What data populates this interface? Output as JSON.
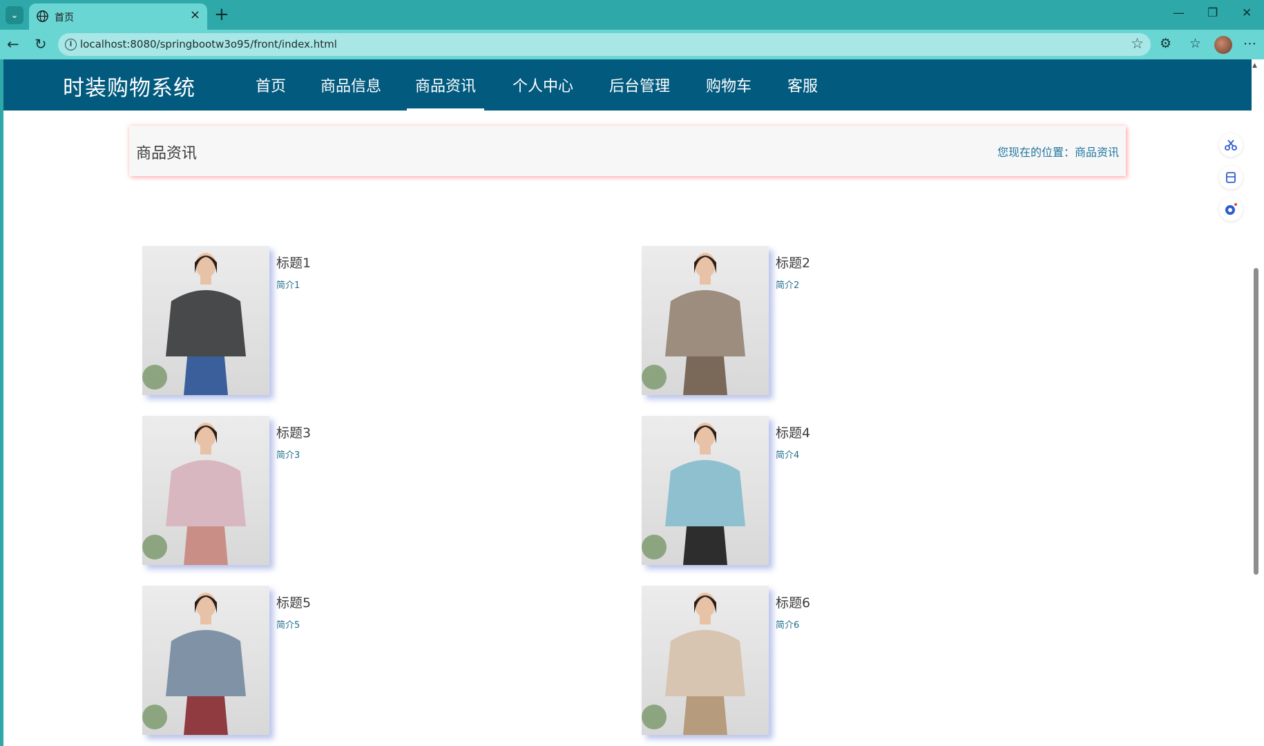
{
  "browser": {
    "tab_title": "首页",
    "url": "localhost:8080/springbootw3o95/front/index.html"
  },
  "site": {
    "logo": "时装购物系统",
    "menu": [
      {
        "label": "首页"
      },
      {
        "label": "商品信息"
      },
      {
        "label": "商品资讯",
        "active": true
      },
      {
        "label": "个人中心"
      },
      {
        "label": "后台管理"
      },
      {
        "label": "购物车"
      },
      {
        "label": "客服"
      }
    ]
  },
  "breadcrumb": {
    "title": "商品资讯",
    "position_label": "您现在的位置：",
    "position_value": "商品资讯"
  },
  "news": [
    {
      "title": "标题1",
      "intro": "简介1",
      "sweater": "#48494a",
      "pants": "#3b5f9a",
      "skin": "#e7c2a6"
    },
    {
      "title": "标题2",
      "intro": "简介2",
      "sweater": "#9c8d7e",
      "pants": "#7a6958",
      "skin": "#e7c2a6"
    },
    {
      "title": "标题3",
      "intro": "简介3",
      "sweater": "#d9b7c0",
      "pants": "#c98f86",
      "skin": "#e7c2a6"
    },
    {
      "title": "标题4",
      "intro": "简介4",
      "sweater": "#8ec0cf",
      "pants": "#2d2d2d",
      "skin": "#e7c2a6"
    },
    {
      "title": "标题5",
      "intro": "简介5",
      "sweater": "#8093a6",
      "pants": "#8f3b3f",
      "skin": "#e7c2a6"
    },
    {
      "title": "标题6",
      "intro": "简介6",
      "sweater": "#d8c5b1",
      "pants": "#b79b7d",
      "skin": "#e7c2a6"
    }
  ]
}
